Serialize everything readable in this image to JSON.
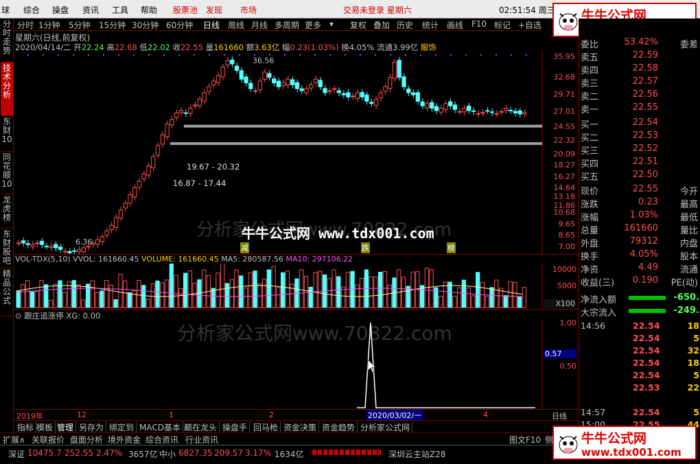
{
  "menu": {
    "items": [
      "球",
      "综合",
      "操盘",
      "资讯",
      "工具",
      "帮助"
    ],
    "red_items": [
      "股票池",
      "发现",
      "市场"
    ],
    "trade_status": "交易未登录 星期六",
    "clock": "02:51:54 周三"
  },
  "left_tabs": [
    "分时走势",
    "技术分析",
    "东财10",
    "同花顺10",
    "龙虎榜",
    "东财股吧",
    "精品公式"
  ],
  "period_tabs": [
    "分时",
    "1分钟",
    "5分钟",
    "15分钟",
    "30分钟",
    "60分钟",
    "日线",
    "周线",
    "月线",
    "多周期",
    "更多"
  ],
  "active_period": "日线",
  "tool_tabs": [
    "复权",
    "叠加",
    "历史",
    "统计",
    "画线",
    "F10",
    "标记",
    "+自选"
  ],
  "chart_header": "星期六(日线,前复权)",
  "quote_line": {
    "date": "2020/04/14/二",
    "open_label": "开",
    "open": "22.24",
    "high_label": "高",
    "high": "22.68",
    "low_label": "低",
    "low": "22.02",
    "close_label": "收",
    "close": "22.55",
    "vol_label": "量",
    "vol": "161660",
    "amt_label": "额",
    "amt": "3.63亿",
    "chg_label": "幅",
    "chg": "0.23(1.03%)",
    "turn_label": "换",
    "turn": "4.05%",
    "float_label": "流通",
    "float": "3.99亿",
    "industry": "服饰"
  },
  "price_axis": [
    "35.95",
    "32.68",
    "29.71",
    "27.01",
    "24.55",
    "22.32",
    "20.09",
    "18.27",
    "16.27",
    "14.64",
    "13.18",
    "11.86",
    "10.68",
    "9.65",
    "8.65",
    "7.00"
  ],
  "annotations": {
    "high_mark": "36.56",
    "low_mark": "6.36",
    "gap1": "19.67 - 20.32",
    "gap2": "16.87 - 17.44",
    "tag1": "减",
    "tag2": "跌",
    "tag3": "榜"
  },
  "watermark_center": "牛牛公式网 www.tdx001.com",
  "watermark_gray1": "分析家公式网www.70822.com",
  "watermark_gray2": "分析家公式网www.70822.com",
  "volume_header": {
    "name": "VOL-TDX(5,10)",
    "vvol": "VVOL: 161660.45",
    "volume": "VOLUME: 161660.45",
    "ma5": "MA5: 280587.56",
    "ma10": "MA10: 297106.22"
  },
  "volume_axis": [
    "10000",
    "5000",
    "X100"
  ],
  "indicator_header": {
    "name": "跟庄追涨停",
    "xg": "XG: 0.00"
  },
  "indicator_axis": [
    "1.00",
    "0.57",
    "0.50"
  ],
  "time_axis": [
    "2019年",
    "12",
    "1",
    "2",
    "2020/03/02/一",
    "4"
  ],
  "time_axis_right": "日线",
  "bottom_tabs": [
    "指标",
    "模板",
    "管理",
    "另存为",
    "绑定到",
    "MACD基本",
    "巅在龙头",
    "操盘手",
    "回马枪",
    "资金决策",
    "资金趋势",
    "分析家公式网"
  ],
  "bottom_tabs2": [
    "扩展∧",
    "关联报价",
    "盘面分析",
    "境外资金",
    "综合资讯",
    "行业资讯"
  ],
  "bottom_right": [
    "图文F10",
    "侧边"
  ],
  "order_book": {
    "weibi_label": "委比",
    "weibi": "53.42%",
    "weicha_label": "委差",
    "sells": [
      {
        "label": "卖五",
        "price": "22.59"
      },
      {
        "label": "卖四",
        "price": "22.58"
      },
      {
        "label": "卖三",
        "price": "22.57"
      },
      {
        "label": "卖二",
        "price": "22.56"
      },
      {
        "label": "卖一",
        "price": "22.55"
      }
    ],
    "buys": [
      {
        "label": "买一",
        "price": "22.54"
      },
      {
        "label": "买二",
        "price": "22.53"
      },
      {
        "label": "买三",
        "price": "22.52"
      },
      {
        "label": "买四",
        "price": "22.51"
      },
      {
        "label": "买五",
        "price": "22.50"
      }
    ]
  },
  "stats": [
    {
      "l": "现价",
      "v": "22.55",
      "r": "今开"
    },
    {
      "l": "涨跌",
      "v": "0.23",
      "r": "最高"
    },
    {
      "l": "涨幅",
      "v": "1.03%",
      "r": "最低"
    },
    {
      "l": "总量",
      "v": "161660",
      "r": "量比"
    },
    {
      "l": "外盘",
      "v": "79312",
      "r": "内盘"
    },
    {
      "l": "换手",
      "v": "4.05%",
      "r": "股本"
    },
    {
      "l": "净资",
      "v": "4.49",
      "r": "流通"
    },
    {
      "l": "收益(三)",
      "v": "0.190",
      "r": "PE(动)"
    }
  ],
  "flows": [
    {
      "l": "净流入额",
      "v": "-650."
    },
    {
      "l": "大宗流入",
      "v": "-249."
    }
  ],
  "ticks": [
    {
      "t": "14:56",
      "p": "22.54",
      "q": "18"
    },
    {
      "t": "",
      "p": "22.54",
      "q": "5"
    },
    {
      "t": "",
      "p": "22.54",
      "q": "32"
    },
    {
      "t": "",
      "p": "22.54",
      "q": "18"
    },
    {
      "t": "",
      "p": "22.54",
      "q": "5"
    },
    {
      "t": "",
      "p": "22.53",
      "q": "22"
    },
    {
      "t": "14:57",
      "p": "22.54",
      "q": "5"
    },
    {
      "t": "15:00",
      "p": "22.55",
      "q": "44"
    }
  ],
  "logo": {
    "title": "牛牛公式网",
    "url": "www.tdx001.com"
  },
  "status_bar": {
    "sz_label": "深证",
    "sz_val": "10475.7",
    "sz_chg": "252.55",
    "sz_pct": "2.47%",
    "sz_amt": "3657亿",
    "zx_label": "中小",
    "zx_val": "6827.35",
    "zx_chg": "209.57",
    "zx_pct": "3.17%",
    "zx_amt": "1634亿",
    "server": "深圳云主站Z28"
  },
  "colors": {
    "up": "#ff5050",
    "down": "#54ffff",
    "bg": "#000000",
    "grid": "#800000",
    "accent": "#c00000"
  }
}
